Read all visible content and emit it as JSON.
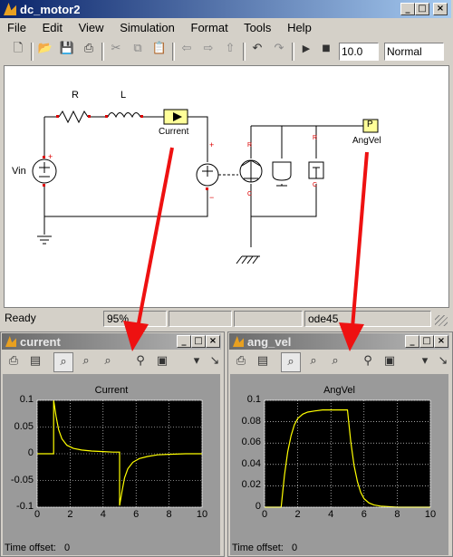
{
  "main_window": {
    "title": "dc_motor2",
    "menu": [
      "File",
      "Edit",
      "View",
      "Simulation",
      "Format",
      "Tools",
      "Help"
    ],
    "stop_time": "10.0",
    "sim_mode": "Normal",
    "status": {
      "state": "Ready",
      "zoom": "95%",
      "solver": "ode45"
    },
    "blocks": {
      "r_label": "R",
      "l_label": "L",
      "vin_label": "Vin",
      "current_label": "Current",
      "angvel_label": "AngVel",
      "port_label": "P",
      "plus": "+",
      "minus": "−",
      "r_mark": "R",
      "c_mark": "C"
    }
  },
  "scopes": [
    {
      "title": "current",
      "time_offset_label": "Time offset:",
      "time_offset": "0",
      "chart_data": {
        "type": "line",
        "title": "Current",
        "xlim": [
          0,
          10
        ],
        "ylim": [
          -0.1,
          0.1
        ],
        "xticks": [
          "0",
          "2",
          "4",
          "6",
          "8",
          "10"
        ],
        "yticks": [
          "0.1",
          "0.05",
          "0",
          "-0.05",
          "-0.1"
        ],
        "grid": true,
        "series": [
          {
            "color": "#ffff00",
            "x": [
              0,
              1,
              1,
              1.15,
              1.3,
              1.5,
              1.8,
              2.2,
              2.7,
              3.3,
              4,
              4.6,
              5,
              5,
              5.15,
              5.3,
              5.5,
              5.8,
              6.2,
              6.7,
              7.3,
              8,
              9,
              10
            ],
            "y": [
              0,
              0,
              0.1,
              0.07,
              0.045,
              0.028,
              0.016,
              0.01,
              0.007,
              0.005,
              0.004,
              0.003,
              0.003,
              -0.097,
              -0.07,
              -0.045,
              -0.028,
              -0.016,
              -0.009,
              -0.005,
              -0.002,
              -0.001,
              0,
              0
            ]
          }
        ]
      }
    },
    {
      "title": "ang_vel",
      "time_offset_label": "Time offset:",
      "time_offset": "0",
      "chart_data": {
        "type": "line",
        "title": "AngVel",
        "xlim": [
          0,
          10
        ],
        "ylim": [
          0,
          0.1
        ],
        "xticks": [
          "0",
          "2",
          "4",
          "6",
          "8",
          "10"
        ],
        "yticks": [
          "0.1",
          "0.08",
          "0.06",
          "0.04",
          "0.02",
          "0"
        ],
        "grid": true,
        "series": [
          {
            "color": "#ffff00",
            "x": [
              0,
              1,
              1.2,
              1.4,
              1.6,
              1.8,
              2,
              2.3,
              2.6,
              3,
              3.5,
              4,
              4.5,
              5,
              5.2,
              5.4,
              5.6,
              5.8,
              6,
              6.3,
              6.6,
              7,
              8,
              9,
              10
            ],
            "y": [
              0,
              0,
              0.03,
              0.052,
              0.067,
              0.077,
              0.083,
              0.087,
              0.089,
              0.09,
              0.091,
              0.091,
              0.091,
              0.091,
              0.061,
              0.039,
              0.024,
              0.014,
              0.008,
              0.004,
              0.002,
              0.001,
              0,
              0,
              0
            ]
          }
        ]
      }
    }
  ],
  "colors": {
    "title_active": "#0a246a",
    "arrow": "#ee1111",
    "trace": "#ffff00",
    "block_fill": "#ffff99"
  }
}
